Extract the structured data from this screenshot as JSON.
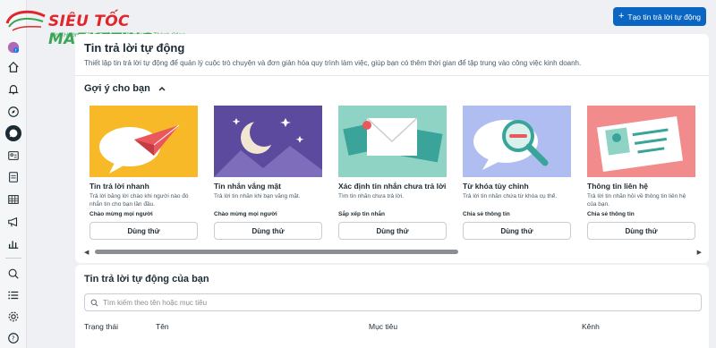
{
  "logo": {
    "brand_part1": "SIÊU TỐC",
    "brand_part2": "MARKETING",
    "tagline": "Định Hướng Tăng Trưởng - Đồng Hành Thành Công"
  },
  "header": {
    "create_button_label": "Tạo tin trả lời tự động"
  },
  "main": {
    "title": "Tin trả lời tự động",
    "description": "Thiết lập tin trả lời tự động để quản lý cuộc trò chuyện và đơn giản hóa quy trình làm việc, giúp bạn có thêm thời gian để tập trung vào công việc kinh doanh."
  },
  "suggestions": {
    "title": "Gợi ý cho bạn",
    "cards": [
      {
        "title": "Tin trả lời nhanh",
        "desc": "Trả lời bằng lời chào khi người nào đó nhắn tin cho bạn lần đầu.",
        "tag": "Chào mừng mọi người",
        "button": "Dùng thử"
      },
      {
        "title": "Tin nhắn vắng mặt",
        "desc": "Trả lời tin nhắn khi bạn vắng mặt.",
        "tag": "Chào mừng mọi người",
        "button": "Dùng thử"
      },
      {
        "title": "Xác định tin nhắn chưa trả lời",
        "desc": "Tìm tin nhắn chưa trả lời.",
        "tag": "Sắp xếp tin nhắn",
        "button": "Dùng thử"
      },
      {
        "title": "Từ khóa tùy chỉnh",
        "desc": "Trả lời tin nhắn chứa từ khóa cụ thể.",
        "tag": "Chia sẻ thông tin",
        "button": "Dùng thử"
      },
      {
        "title": "Thông tin liên hệ",
        "desc": "Trả lời tin nhắn hỏi về thông tin liên hệ của bạn.",
        "tag": "Chia sẻ thông tin",
        "button": "Dùng thử"
      }
    ]
  },
  "auto_replies": {
    "title": "Tin trả lời tự động của bạn",
    "search_placeholder": "Tìm kiếm theo tên hoặc mục tiêu",
    "columns": [
      "Trạng thái",
      "Tên",
      "Mục tiêu",
      "Kênh"
    ]
  },
  "sidebar": {
    "icons": [
      "meta-avatar-icon",
      "home-icon",
      "bell-icon",
      "compass-icon",
      "chat-icon",
      "contacts-icon",
      "pages-icon",
      "table-icon",
      "megaphone-icon",
      "bar-chart-icon",
      "search-icon",
      "list-icon",
      "gear-icon",
      "help-icon"
    ]
  },
  "colors": {
    "accent": "#0a66c2",
    "brand_red": "#e2252b",
    "brand_green": "#3aa655"
  }
}
